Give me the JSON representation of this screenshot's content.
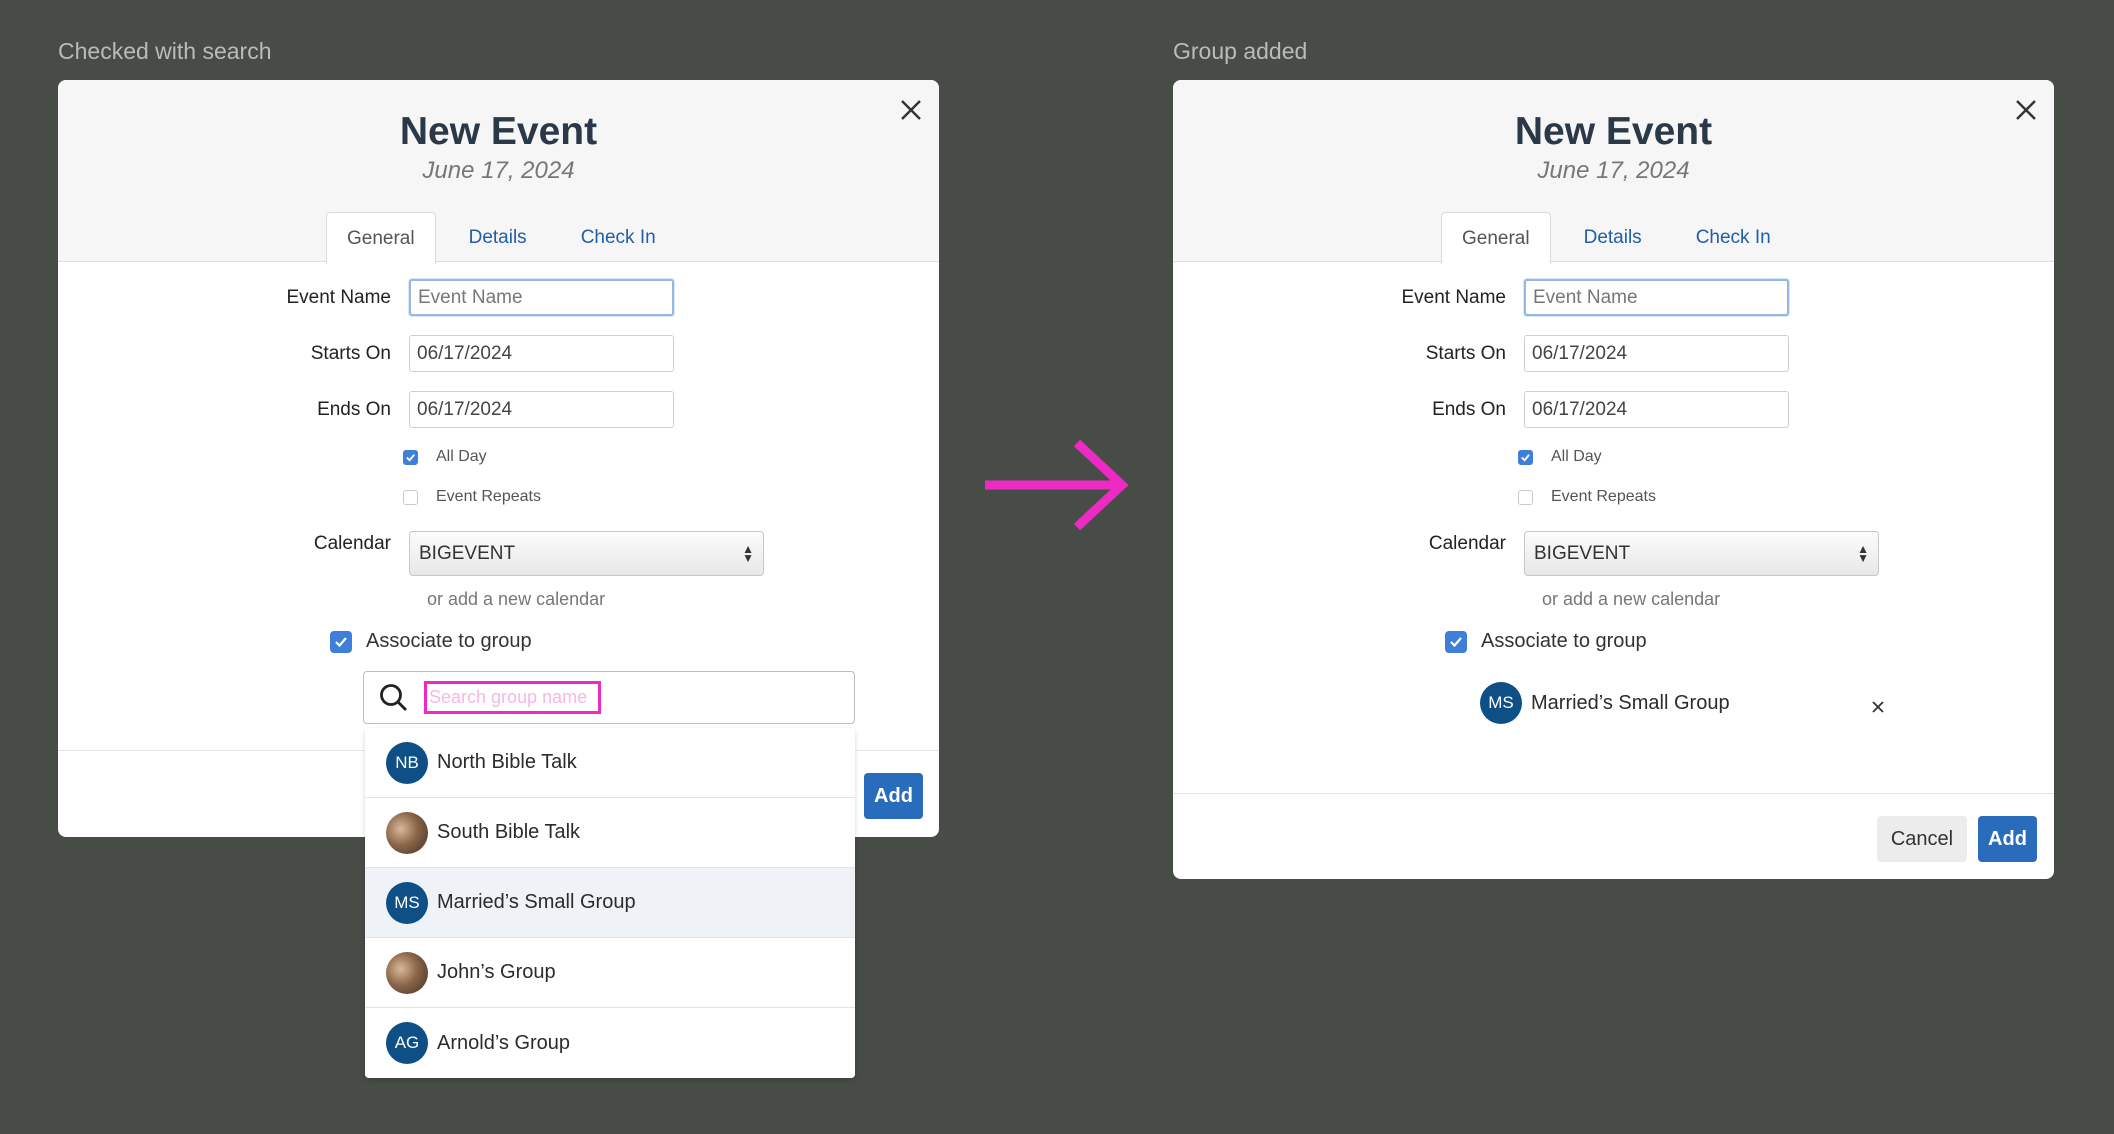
{
  "captions": {
    "left": "Checked with search",
    "right": "Group added"
  },
  "modal": {
    "title": "New Event",
    "date": "June 17, 2024",
    "tabs": [
      "General",
      "Details",
      "Check In"
    ],
    "fields": {
      "event_name_label": "Event Name",
      "event_name_placeholder": "Event Name",
      "starts_on_label": "Starts On",
      "starts_on_value": "06/17/2024",
      "ends_on_label": "Ends On",
      "ends_on_value": "06/17/2024",
      "all_day_label": "All Day",
      "event_repeats_label": "Event Repeats",
      "calendar_label": "Calendar",
      "calendar_value": "BIGEVENT",
      "add_calendar_link": "or add a new calendar",
      "associate_label": "Associate to group"
    },
    "search_placeholder": "Search group name",
    "add_label": "Add",
    "cancel_label": "Cancel"
  },
  "group_options": [
    {
      "initials": "NB",
      "name": "North Bible Talk",
      "photo": false
    },
    {
      "initials": "",
      "name": "South Bible Talk",
      "photo": true
    },
    {
      "initials": "MS",
      "name": "Married’s Small Group",
      "photo": false,
      "highlighted": true
    },
    {
      "initials": "",
      "name": "John’s Group",
      "photo": true
    },
    {
      "initials": "AG",
      "name": "Arnold’s Group",
      "photo": false
    }
  ],
  "selected_group": {
    "initials": "MS",
    "name": "Married’s Small Group"
  },
  "colors": {
    "accent": "#2a6cbc",
    "highlight_magenta": "#ed2bc4",
    "avatar": "#0e4f86"
  }
}
